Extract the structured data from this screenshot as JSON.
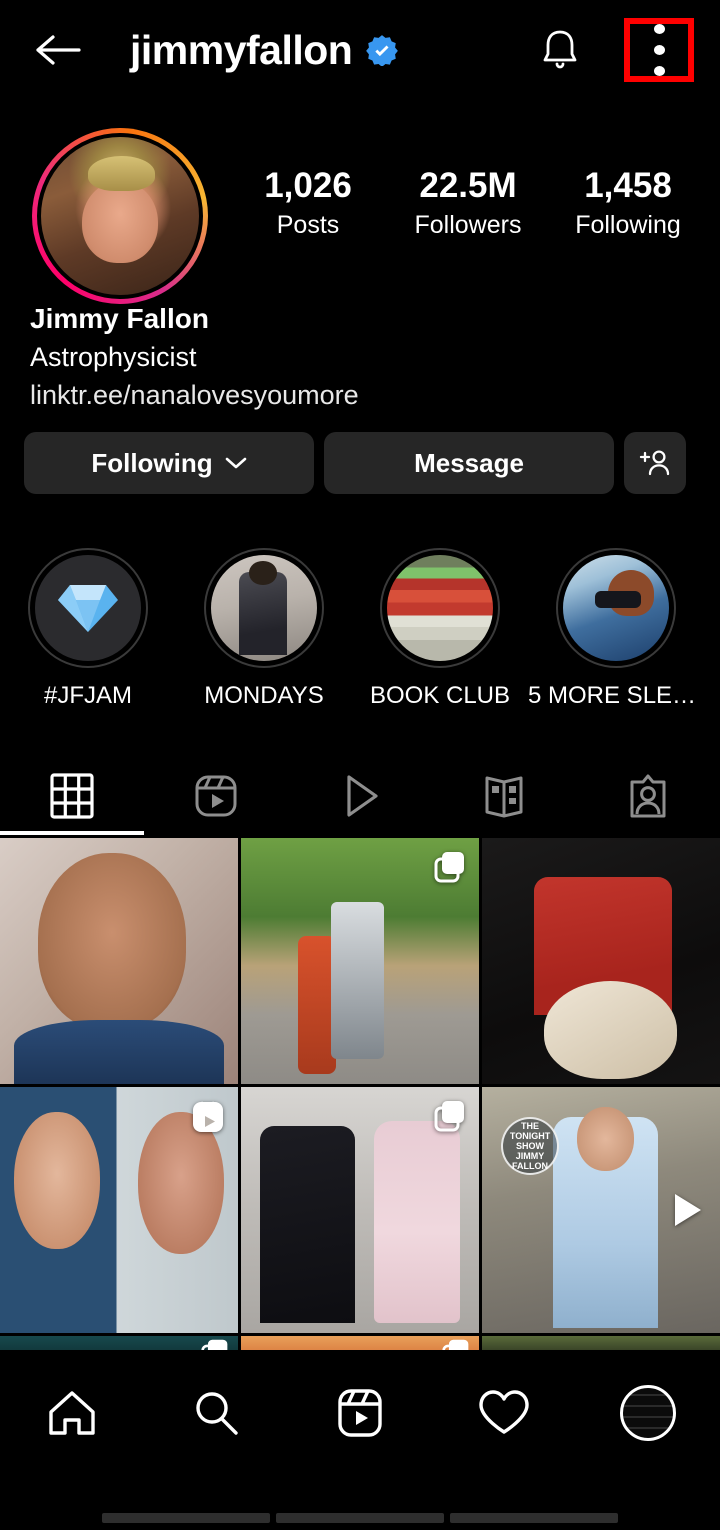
{
  "header": {
    "back_icon": "arrow-left-icon",
    "username": "jimmyfallon",
    "verified_icon": "verified-badge-icon",
    "verified_color": "#3897F0",
    "bell_icon": "bell-icon",
    "menu_icon": "three-dots-menu-icon",
    "highlight_color": "#FF0000"
  },
  "profile": {
    "avatar_name": "profile-avatar",
    "has_story_ring": true,
    "stats": [
      {
        "value": "1,026",
        "label": "Posts"
      },
      {
        "value": "22.5M",
        "label": "Followers"
      },
      {
        "value": "1,458",
        "label": "Following"
      }
    ],
    "display_name": "Jimmy Fallon",
    "category": "Astrophysicist",
    "link": "linktr.ee/nanalovesyoumore"
  },
  "actions": {
    "following_label": "Following",
    "message_label": "Message",
    "add_user_icon": "add-person-icon",
    "chevron_icon": "chevron-down-icon"
  },
  "highlights": [
    {
      "label": "#JFJAM",
      "art": "hl1"
    },
    {
      "label": "MONDAYS",
      "art": "hl2"
    },
    {
      "label": "BOOK CLUB",
      "art": "hl3"
    },
    {
      "label": "5 MORE SLEE...",
      "art": "hl4"
    }
  ],
  "tabs": [
    {
      "name": "tab-grid",
      "icon": "grid-icon",
      "active": true
    },
    {
      "name": "tab-reels",
      "icon": "reels-icon",
      "active": false
    },
    {
      "name": "tab-video",
      "icon": "play-triangle-icon",
      "active": false
    },
    {
      "name": "tab-guides",
      "icon": "guides-book-icon",
      "active": false
    },
    {
      "name": "tab-tagged",
      "icon": "tagged-person-icon",
      "active": false
    }
  ],
  "grid": [
    {
      "name": "post-1",
      "art": "c1",
      "badge": "none",
      "alt": "Smiling man in blue jacket"
    },
    {
      "name": "post-2",
      "art": "c2",
      "badge": "carousel",
      "alt": "Two people riding scooters on a wooded trail"
    },
    {
      "name": "post-3",
      "art": "c3",
      "badge": "none",
      "alt": "Man in red T-BIRD jersey holding a white guitar"
    },
    {
      "name": "post-4",
      "art": "c4",
      "badge": "reels",
      "alt": "Split image of two faces"
    },
    {
      "name": "post-5",
      "art": "c5",
      "badge": "carousel",
      "alt": "Man in suit posing with woman in pink dress"
    },
    {
      "name": "post-6",
      "art": "c6",
      "badge": "video",
      "alt": "Man in light blue shirt with tie on a talk show set",
      "overlay_logo": "THE TONIGHT SHOW JIMMY FALLON"
    },
    {
      "name": "post-7",
      "art": "c7",
      "badge": "carousel",
      "alt": "Partially visible post"
    },
    {
      "name": "post-8",
      "art": "c8",
      "badge": "carousel",
      "alt": "Partially visible post"
    },
    {
      "name": "post-9",
      "art": "c9",
      "badge": "none",
      "alt": "Partially visible post"
    }
  ],
  "bottom_nav": [
    {
      "name": "nav-home",
      "icon": "home-icon"
    },
    {
      "name": "nav-search",
      "icon": "search-icon"
    },
    {
      "name": "nav-reels",
      "icon": "reels-icon"
    },
    {
      "name": "nav-activity",
      "icon": "heart-icon"
    },
    {
      "name": "nav-profile",
      "icon": "profile-avatar-icon"
    }
  ]
}
